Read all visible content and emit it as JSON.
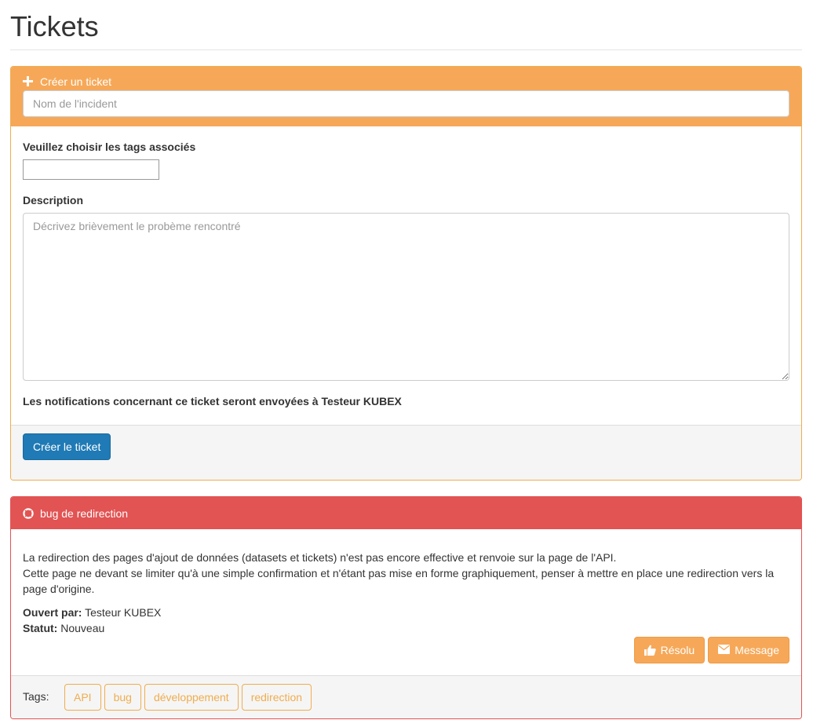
{
  "page": {
    "title": "Tickets"
  },
  "create_panel": {
    "header_label": "Créer un ticket",
    "incident_placeholder": "Nom de l'incident",
    "tags_label": "Veuillez choisir les tags associés",
    "description_label": "Description",
    "description_placeholder": "Décrivez brièvement le probème rencontré",
    "notification_text": "Les notifications concernant ce ticket seront envoyées à Testeur KUBEX",
    "submit_label": "Créer le ticket"
  },
  "ticket": {
    "title": "bug de redirection",
    "description_lines": [
      "La redirection des pages d'ajout de données (datasets et tickets) n'est pas encore effective et renvoie sur la page de l'API.",
      "Cette page ne devant se limiter qu'à une simple confirmation et n'étant pas mise en forme graphiquement, penser à mettre en place une redirection vers la",
      "page d'origine."
    ],
    "opened_by_label": "Ouvert par:",
    "opened_by_value": "Testeur KUBEX",
    "status_label": "Statut:",
    "status_value": "Nouveau",
    "resolve_label": "Résolu",
    "message_label": "Message",
    "tags_label": "Tags:",
    "tags": [
      "API",
      "bug",
      "développement",
      "redirection"
    ]
  },
  "colors": {
    "warning": "#f6a858",
    "danger": "#e25353",
    "primary": "#1f7ab5"
  },
  "icons": {
    "create_header": "plus-icon",
    "ticket_header": "life-ring-icon",
    "resolve": "thumbs-up-icon",
    "message": "envelope-icon"
  }
}
